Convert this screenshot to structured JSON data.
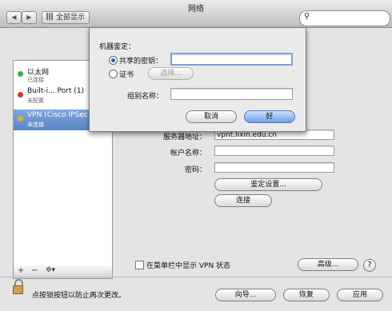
{
  "window": {
    "title": "网络"
  },
  "toolbar": {
    "back": "◀",
    "forward": "▶",
    "show_all": "全部显示",
    "search_placeholder": ""
  },
  "services": [
    {
      "name": "以太网",
      "status": "已连接",
      "color": "#3cae3c"
    },
    {
      "name": "Built-i... Port (1)",
      "status": "未配置",
      "color": "#d23a2c"
    },
    {
      "name": "VPN (Cisco IPSec)",
      "status": "未连接",
      "color": "#e0b02a",
      "selected": true
    }
  ],
  "list_controls": {
    "add": "+",
    "remove": "−",
    "action": "✲▾"
  },
  "config": {
    "server_label": "服务器地址：",
    "server_value": "vpnt.lixin.edu.cn",
    "account_label": "帐户名称：",
    "account_value": "",
    "password_label": "密码：",
    "password_value": "",
    "auth_button": "鉴定设置...",
    "connect_button": "连接",
    "show_vpn_status": "在菜单栏中显示 VPN 状态",
    "advanced_button": "高级...",
    "help": "?"
  },
  "dialog": {
    "section": "机器鉴定：",
    "shared_secret_label": "共享的密钥：",
    "shared_secret_value": "",
    "certificate_label": "证书",
    "select_button": "选择...",
    "group_label": "组别名称：",
    "group_value": "",
    "cancel_button": "取消",
    "ok_button": "好"
  },
  "footer": {
    "lock_text": "点按锁按钮以防止再次更改。",
    "assistant_button": "向导...",
    "revert_button": "恢复",
    "apply_button": "应用"
  }
}
